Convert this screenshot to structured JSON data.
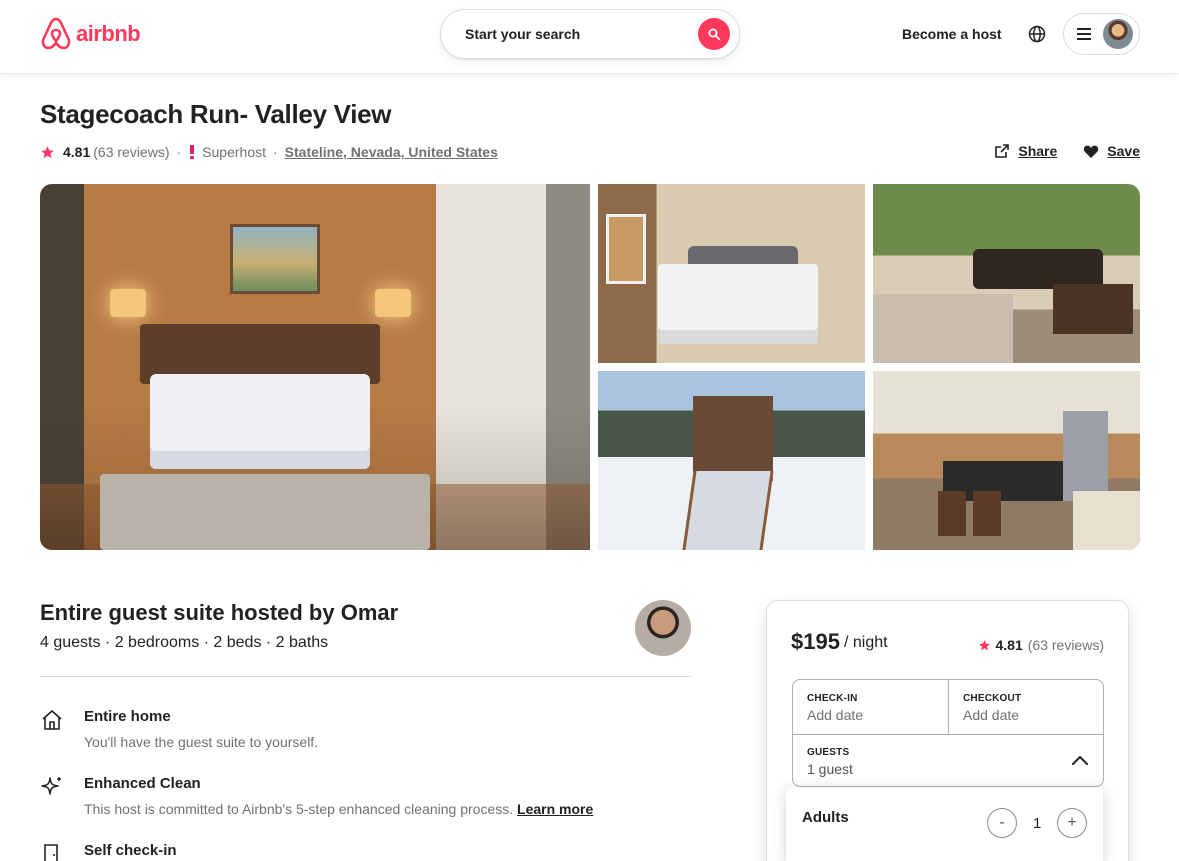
{
  "header": {
    "logo_text": "airbnb",
    "search_placeholder": "Start your search",
    "become_host": "Become a host",
    "brand_color": "#FF385C"
  },
  "listing": {
    "title": "Stagecoach Run- Valley View",
    "rating": "4.81",
    "reviews": "(63 reviews)",
    "superhost": "Superhost",
    "location": "Stateline, Nevada, United States",
    "share": "Share",
    "save": "Save"
  },
  "gallery": {
    "photos": [
      "bedroom-main",
      "bedroom-2",
      "living-room",
      "snowy-exterior",
      "kitchen"
    ]
  },
  "host_section": {
    "title": "Entire guest suite hosted by Omar",
    "details": "4 guests · 2 bedrooms · 2 beds · 2 baths"
  },
  "features": [
    {
      "icon": "home-icon",
      "title": "Entire home",
      "desc": "You'll have the guest suite to yourself."
    },
    {
      "icon": "sparkle-icon",
      "title": "Enhanced Clean",
      "desc": "This host is committed to Airbnb's 5-step enhanced cleaning process.",
      "link": "Learn more"
    },
    {
      "icon": "door-icon",
      "title": "Self check-in"
    }
  ],
  "booking": {
    "price": "$195",
    "per": "/ night",
    "rating": "4.81",
    "reviews": "(63 reviews)",
    "checkin_label": "CHECK-IN",
    "checkin_value": "Add date",
    "checkout_label": "CHECKOUT",
    "checkout_value": "Add date",
    "guests_label": "GUESTS",
    "guests_value": "1 guest",
    "adults_label": "Adults",
    "adults_count": "1",
    "minus": "-",
    "plus": "+"
  }
}
